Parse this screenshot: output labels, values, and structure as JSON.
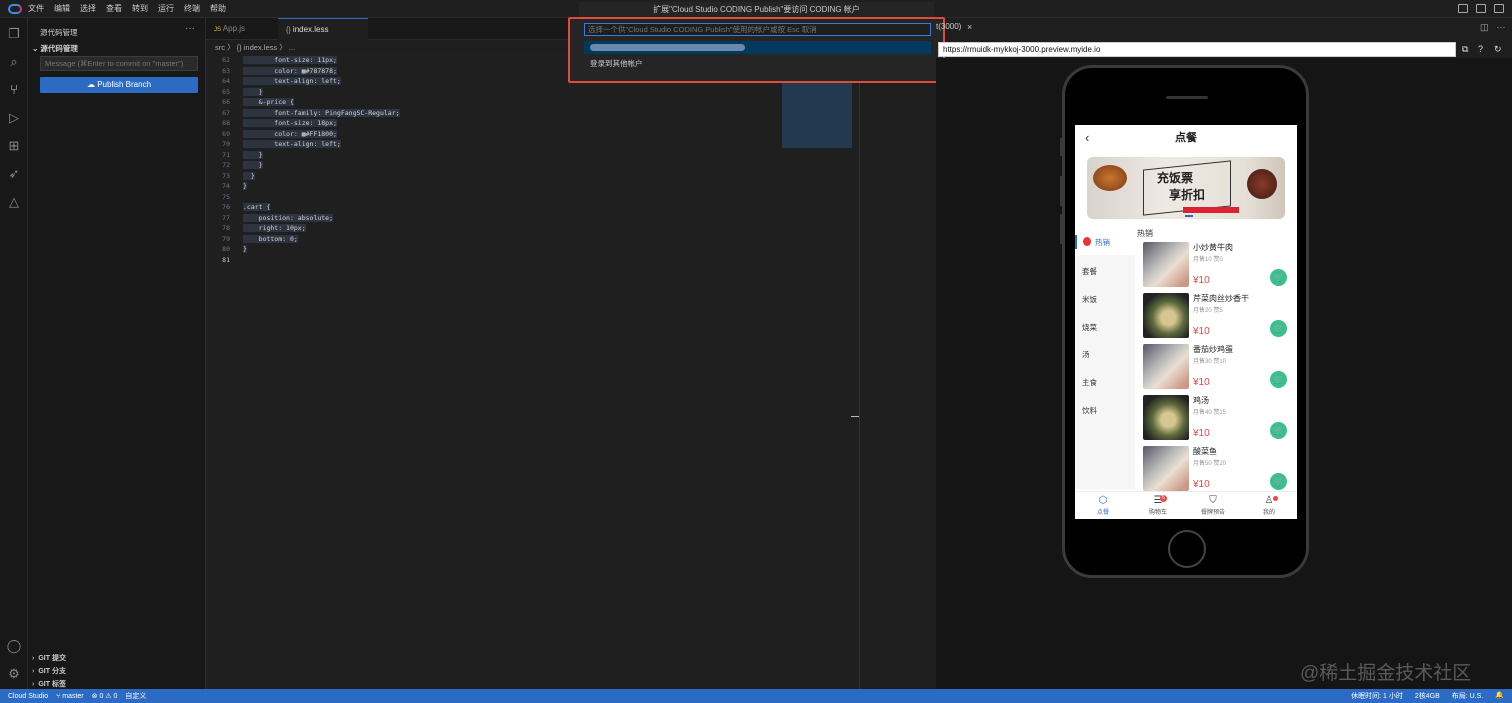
{
  "menubar": {
    "items": [
      "文件",
      "编辑",
      "选择",
      "查看",
      "转到",
      "运行",
      "终端",
      "帮助"
    ]
  },
  "quickpick": {
    "title": "扩展\"Cloud Studio CODING Publish\"要访问 CODING 帐户",
    "placeholder": "选择一个供\"Cloud Studio CODING Publish\"使用的帐户或按 Esc 取消",
    "other_account": "登录到其他帐户"
  },
  "sidebar": {
    "title": "源代码管理",
    "more": "···",
    "section": "源代码管理",
    "commit_placeholder": "Message (⌘Enter to commit on \"master\")",
    "publish_button": "Publish Branch",
    "git_sections": [
      "GIT 提交",
      "GIT 分支",
      "GIT 标签"
    ]
  },
  "editor": {
    "tabs": [
      {
        "label": "App.js",
        "icon": "JS",
        "active": false
      },
      {
        "label": "index.less",
        "icon": "{}",
        "active": true
      }
    ],
    "breadcrumb": "src 〉 {} index.less 〉 ...",
    "lines": [
      {
        "n": "62",
        "text": "        font-size: 11px;"
      },
      {
        "n": "63",
        "text": "        color: ▩#787878;"
      },
      {
        "n": "64",
        "text": "        text-align: left;"
      },
      {
        "n": "65",
        "text": "    }"
      },
      {
        "n": "66",
        "text": "    &-price {"
      },
      {
        "n": "67",
        "text": "        font-family: PingFangSC-Regular;"
      },
      {
        "n": "68",
        "text": "        font-size: 18px;"
      },
      {
        "n": "69",
        "text": "        color: ▩#FF1800;"
      },
      {
        "n": "70",
        "text": "        text-align: left;"
      },
      {
        "n": "71",
        "text": "    }"
      },
      {
        "n": "72",
        "text": "    }"
      },
      {
        "n": "73",
        "text": "  }"
      },
      {
        "n": "74",
        "text": "}"
      },
      {
        "n": "75",
        "text": ""
      },
      {
        "n": "76",
        "text": ".cart {"
      },
      {
        "n": "77",
        "text": "    position: absolute;"
      },
      {
        "n": "78",
        "text": "    right: 10px;"
      },
      {
        "n": "79",
        "text": "    bottom: 0;"
      },
      {
        "n": "80",
        "text": "}"
      },
      {
        "n": "81",
        "text": ""
      }
    ]
  },
  "preview": {
    "tab_label": "t(3000)",
    "tab_close": "×",
    "url": "https://rmuidk-mykkoj-3000.preview.myide.io",
    "app": {
      "header_title": "点餐",
      "back": "‹",
      "banner_text1": "充饭票",
      "banner_text2": "享折扣",
      "categories": [
        "热销",
        "套餐",
        "米饭",
        "烧菜",
        "汤",
        "主食",
        "饮料"
      ],
      "section_title": "热销",
      "items": [
        {
          "name": "小炒黄牛肉",
          "meta": "月售10  赞0",
          "price": "¥10"
        },
        {
          "name": "芹菜肉丝炒香干",
          "meta": "月售20  赞5",
          "price": "¥10"
        },
        {
          "name": "番茄炒鸡蛋",
          "meta": "月售30  赞10",
          "price": "¥10"
        },
        {
          "name": "鸡汤",
          "meta": "月售40  赞15",
          "price": "¥10"
        },
        {
          "name": "酸菜鱼",
          "meta": "月售50  赞20",
          "price": "¥10"
        }
      ],
      "tabbar": [
        "点餐",
        "购物车",
        "餐牌预告",
        "我的"
      ],
      "cart_badge": "5"
    }
  },
  "watermark": "@稀土掘金技术社区",
  "statusbar": {
    "remote": "Cloud Studio",
    "branch": "master",
    "problems": "⊗ 0 ⚠ 0",
    "custom": "自定义",
    "rest_time": "休眠时间: 1 小时",
    "machine": "2核4GB",
    "layout": "布局: U.S.",
    "accent": "#2c6bc4"
  }
}
